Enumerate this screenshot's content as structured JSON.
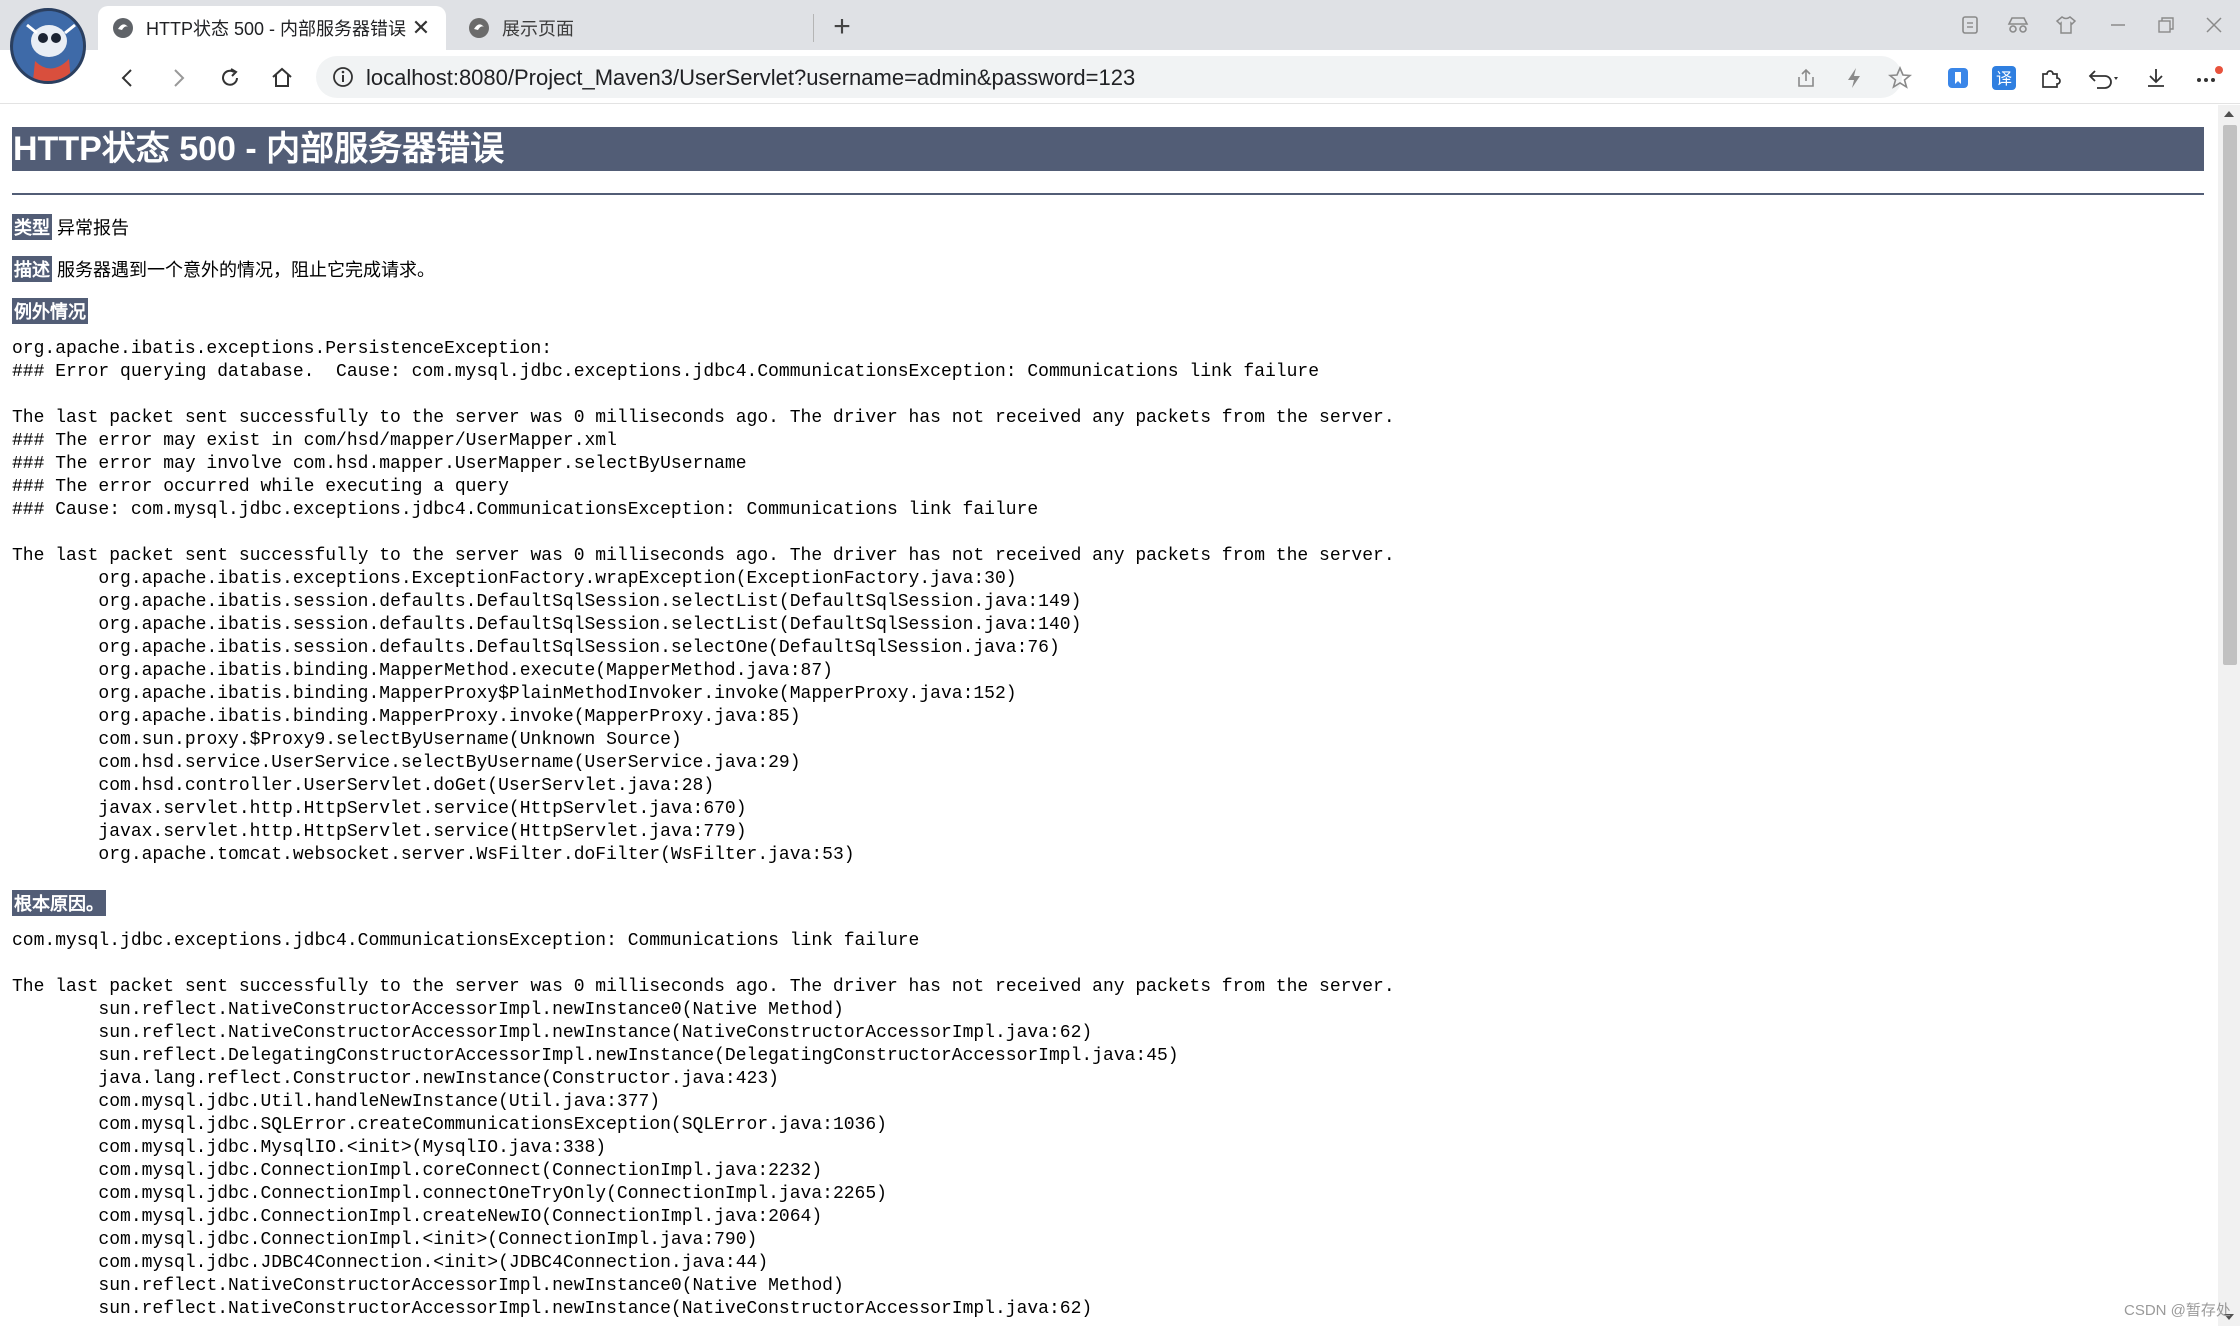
{
  "browser": {
    "tabs": [
      {
        "title": "HTTP状态 500 - 内部服务器错误",
        "close": "✕",
        "active": true
      },
      {
        "title": "展示页面",
        "active": false
      }
    ],
    "new_tab": "+",
    "url": "localhost:8080/Project_Maven3/UserServlet?username=admin&password=123"
  },
  "page": {
    "title": "HTTP状态 500 - 内部服务器错误",
    "type_label": "类型",
    "type_value": "异常报告",
    "desc_label": "描述",
    "desc_value": "服务器遇到一个意外的情况，阻止它完成请求。",
    "exception_label": "例外情况",
    "exception_trace": "org.apache.ibatis.exceptions.PersistenceException:\n### Error querying database.  Cause: com.mysql.jdbc.exceptions.jdbc4.CommunicationsException: Communications link failure\n\nThe last packet sent successfully to the server was 0 milliseconds ago. The driver has not received any packets from the server.\n### The error may exist in com/hsd/mapper/UserMapper.xml\n### The error may involve com.hsd.mapper.UserMapper.selectByUsername\n### The error occurred while executing a query\n### Cause: com.mysql.jdbc.exceptions.jdbc4.CommunicationsException: Communications link failure\n\nThe last packet sent successfully to the server was 0 milliseconds ago. The driver has not received any packets from the server.\n\torg.apache.ibatis.exceptions.ExceptionFactory.wrapException(ExceptionFactory.java:30)\n\torg.apache.ibatis.session.defaults.DefaultSqlSession.selectList(DefaultSqlSession.java:149)\n\torg.apache.ibatis.session.defaults.DefaultSqlSession.selectList(DefaultSqlSession.java:140)\n\torg.apache.ibatis.session.defaults.DefaultSqlSession.selectOne(DefaultSqlSession.java:76)\n\torg.apache.ibatis.binding.MapperMethod.execute(MapperMethod.java:87)\n\torg.apache.ibatis.binding.MapperProxy$PlainMethodInvoker.invoke(MapperProxy.java:152)\n\torg.apache.ibatis.binding.MapperProxy.invoke(MapperProxy.java:85)\n\tcom.sun.proxy.$Proxy9.selectByUsername(Unknown Source)\n\tcom.hsd.service.UserService.selectByUsername(UserService.java:29)\n\tcom.hsd.controller.UserServlet.doGet(UserServlet.java:28)\n\tjavax.servlet.http.HttpServlet.service(HttpServlet.java:670)\n\tjavax.servlet.http.HttpServlet.service(HttpServlet.java:779)\n\torg.apache.tomcat.websocket.server.WsFilter.doFilter(WsFilter.java:53)",
    "root_cause_label": "根本原因。",
    "root_cause_trace": "com.mysql.jdbc.exceptions.jdbc4.CommunicationsException: Communications link failure\n\nThe last packet sent successfully to the server was 0 milliseconds ago. The driver has not received any packets from the server.\n\tsun.reflect.NativeConstructorAccessorImpl.newInstance0(Native Method)\n\tsun.reflect.NativeConstructorAccessorImpl.newInstance(NativeConstructorAccessorImpl.java:62)\n\tsun.reflect.DelegatingConstructorAccessorImpl.newInstance(DelegatingConstructorAccessorImpl.java:45)\n\tjava.lang.reflect.Constructor.newInstance(Constructor.java:423)\n\tcom.mysql.jdbc.Util.handleNewInstance(Util.java:377)\n\tcom.mysql.jdbc.SQLError.createCommunicationsException(SQLError.java:1036)\n\tcom.mysql.jdbc.MysqlIO.<init>(MysqlIO.java:338)\n\tcom.mysql.jdbc.ConnectionImpl.coreConnect(ConnectionImpl.java:2232)\n\tcom.mysql.jdbc.ConnectionImpl.connectOneTryOnly(ConnectionImpl.java:2265)\n\tcom.mysql.jdbc.ConnectionImpl.createNewIO(ConnectionImpl.java:2064)\n\tcom.mysql.jdbc.ConnectionImpl.<init>(ConnectionImpl.java:790)\n\tcom.mysql.jdbc.JDBC4Connection.<init>(JDBC4Connection.java:44)\n\tsun.reflect.NativeConstructorAccessorImpl.newInstance0(Native Method)\n\tsun.reflect.NativeConstructorAccessorImpl.newInstance(NativeConstructorAccessorImpl.java:62)"
  },
  "watermark": "CSDN @暂存处",
  "colors": {
    "header_bg": "#525d76",
    "tabstrip_bg": "#dfe1e5"
  }
}
